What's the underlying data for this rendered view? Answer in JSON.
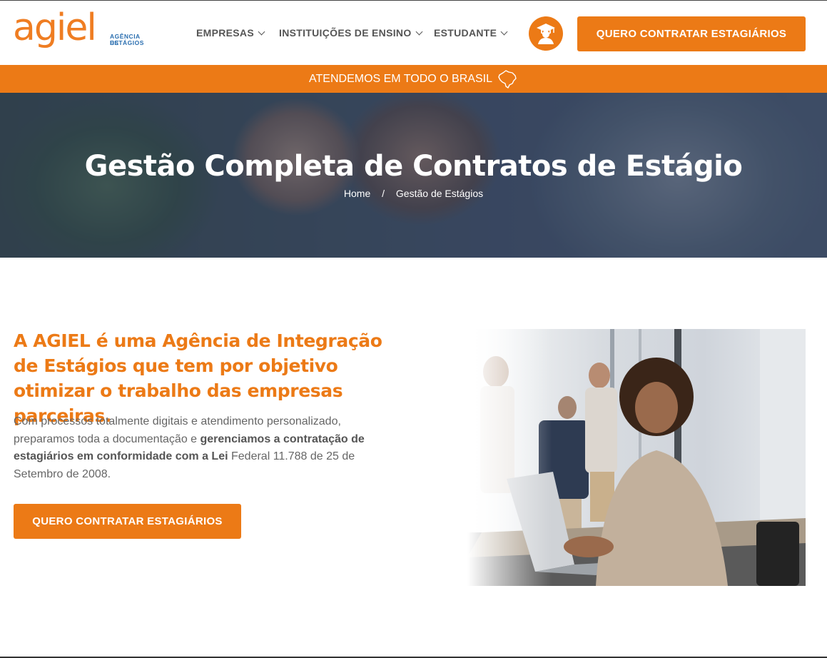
{
  "header": {
    "logo": {
      "word": "agiel",
      "sub_line1": "AGÊNCIA DE",
      "sub_line2": "ESTÁGIOS"
    },
    "nav": [
      {
        "label": "EMPRESAS"
      },
      {
        "label": "INSTITUIÇÕES DE ENSINO"
      },
      {
        "label": "ESTUDANTE"
      }
    ],
    "student_icon": "graduate-icon",
    "cta_label": "QUERO CONTRATAR ESTAGIÁRIOS"
  },
  "banner": {
    "text": "ATENDEMOS EM TODO O BRASIL",
    "icon": "brazil-map-icon"
  },
  "hero": {
    "title": "Gestão Completa de Contratos de Estágio",
    "breadcrumb": {
      "home": "Home",
      "separator": "/",
      "current": "Gestão de Estágios"
    }
  },
  "intro": {
    "heading": "A AGIEL é uma Agência de Integração de Estágios que tem por objetivo otimizar o trabalho das empresas parceiras.",
    "p_part1": "Com processos totalmente digitais e atendimento personalizado, preparamos toda a documentação e ",
    "p_bold": "gerenciamos a contratação de estagiários em conformidade com a Lei",
    "p_part2": " Federal 11.788 de 25 de Setembro de 2008.",
    "cta_label": "QUERO CONTRATAR ESTAGIÁRIOS"
  },
  "colors": {
    "accent": "#ec7a16",
    "logo_blue": "#2b6fb0",
    "text": "#666666"
  }
}
